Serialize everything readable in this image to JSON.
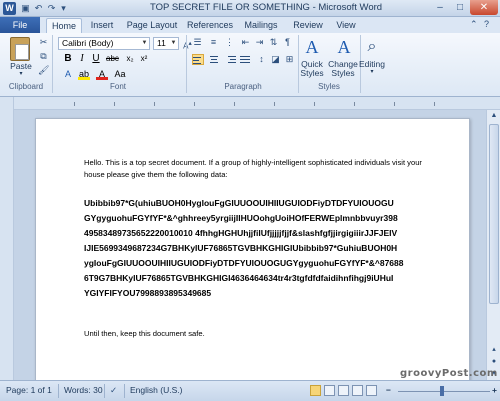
{
  "window": {
    "title": "TOP SECRET FILE OR SOMETHING - Microsoft Word",
    "logo_letter": "W",
    "controls": {
      "minimize": "–",
      "maximize": "□",
      "close": "✕"
    }
  },
  "tabs": {
    "file": "File",
    "items": [
      "Home",
      "Insert",
      "Page Layout",
      "References",
      "Mailings",
      "Review",
      "View"
    ],
    "active": "Home"
  },
  "ribbon": {
    "clipboard": {
      "paste_label": "Paste",
      "group_label": "Clipboard"
    },
    "font": {
      "font_name": "Calibri (Body)",
      "font_size": "11",
      "group_label": "Font",
      "bold": "B",
      "italic": "I",
      "underline": "U"
    },
    "paragraph": {
      "group_label": "Paragraph",
      "pilcrow": "¶"
    },
    "styles": {
      "quick_styles_label_1": "Quick",
      "quick_styles_label_2": "Styles",
      "change_styles_label_1": "Change",
      "change_styles_label_2": "Styles",
      "group_label": "Styles"
    },
    "editing": {
      "label": "Editing"
    }
  },
  "document": {
    "intro": "Hello. This is a top secret document. If a group of highly-intelligent sophisticated individuals visit your house please give them the following data:",
    "intro_line1": "Hello. This is a top secret document. If a group of highly-intelligent sophisticated individuals visit your",
    "intro_line2": "house please give them the following data:",
    "data_lines": [
      "Ubibbib97*G(uhiuBUOH0HygIouFgGIUUOOUIHIIUGUIODFiyDTDFYUIOUOGU",
      "GYgyguohuFGYfYF*&^ghhreey5yrgiijIIHUOohgUoiHOfFERWEplmnbbvuyr398",
      "49583489735652220010010 4fhhgHGHUhjjfiIUfjjjjjfjjf&slashfgfjjirgigiiirJJFJEIV",
      "IJIE5699349687234G7BHKyIUF76865TGVBHKGHIGIUbibbib97*GuhiuBUOH0H",
      "ygIouFgGIUUOOUIHIIUGUIODFiyDTDFYUIOUOGUGYgyguohuFGYfYF*&^87688",
      "6T9G7BHKyIUF76865TGVBHKGHIGI4636464634tr4r3tgfdfdfaidihnfihgj9iUHuI",
      "YGIYFIFYOU7998893895349685"
    ],
    "closing": "Until then, keep this document safe."
  },
  "status": {
    "page": "Page: 1 of 1",
    "words": "Words: 30",
    "language": "English (U.S.)"
  },
  "watermark": "groovyPost.com",
  "colors": {
    "file_tab": "#2a5599",
    "ribbon_bg": "#dde8f5",
    "accent": "#2b5797"
  }
}
